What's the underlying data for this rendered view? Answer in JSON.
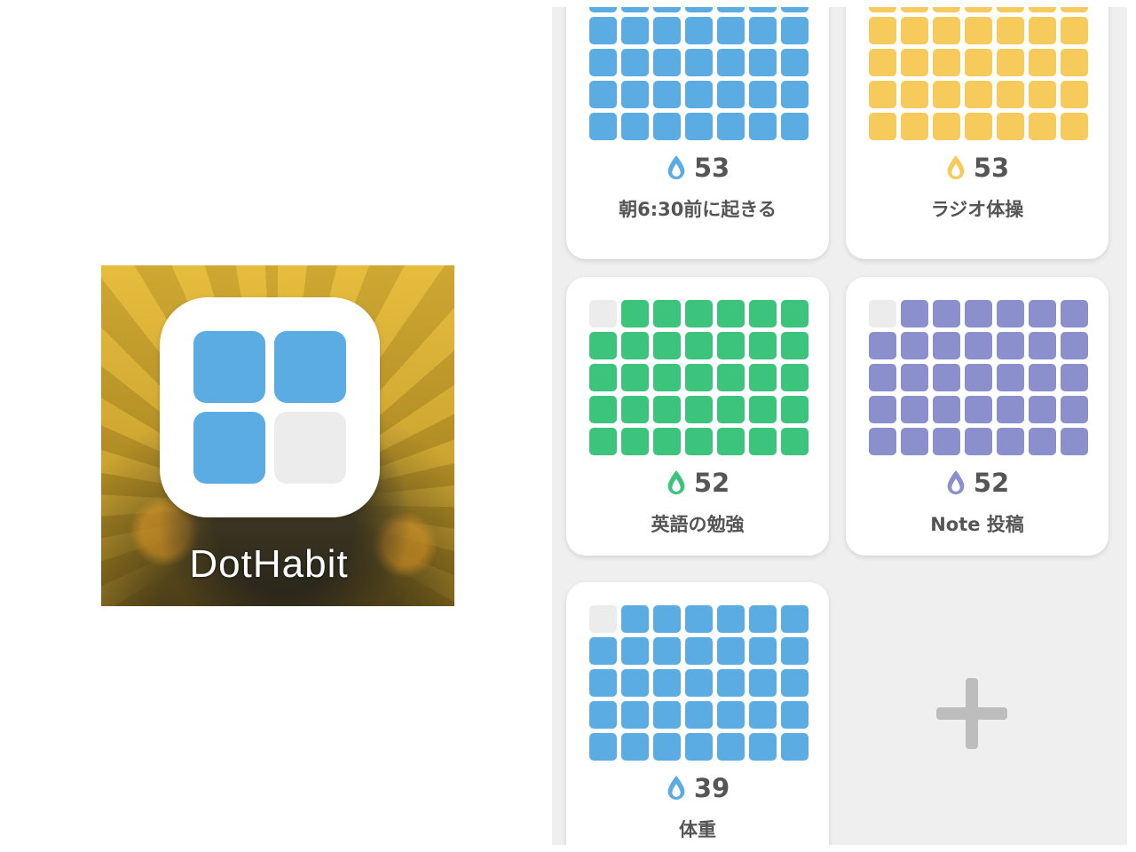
{
  "app_icon": {
    "name": "DotHabit",
    "tile_colors": [
      "#5aace2",
      "#5aace2",
      "#5aace2",
      "#ececec"
    ]
  },
  "colors": {
    "blue": "#5aace2",
    "yellow": "#f6cb5c",
    "green": "#3cc47c",
    "purple": "#8b8fcb",
    "empty": "#ececec"
  },
  "habits": [
    {
      "name": "朝6:30前に起きる",
      "count": "53",
      "color": "#5aace2",
      "empty_first": false
    },
    {
      "name": "ラジオ体操",
      "count": "53",
      "color": "#f6cb5c",
      "empty_first": false
    },
    {
      "name": "英語の勉強",
      "count": "52",
      "color": "#3cc47c",
      "empty_first": true
    },
    {
      "name": "Note 投稿",
      "count": "52",
      "color": "#8b8fcb",
      "empty_first": true
    },
    {
      "name": "体重",
      "count": "39",
      "color": "#5aace2",
      "empty_first": true
    }
  ],
  "add_button": {
    "icon": "plus-icon"
  }
}
